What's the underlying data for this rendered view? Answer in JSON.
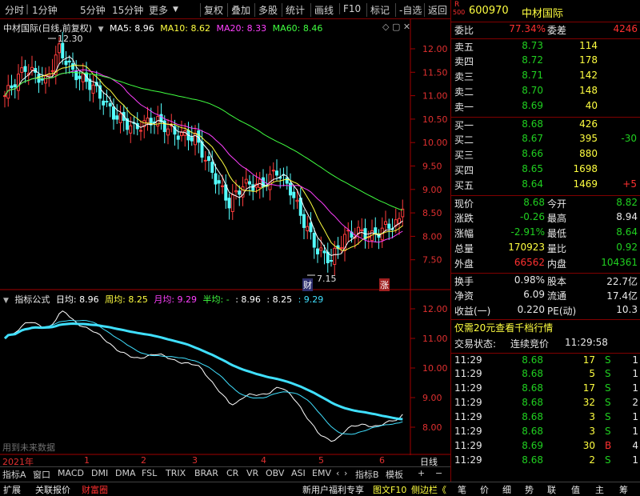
{
  "toolbar": {
    "left_items": [
      "分时",
      "1分钟",
      "5分钟",
      "15分钟",
      "更多"
    ],
    "right_items": [
      "复权",
      "叠加",
      "多股",
      "统计",
      "画线",
      "F10",
      "标记",
      "-自选",
      "返回"
    ]
  },
  "chart": {
    "stock_title": "中材国际(日线,前复权)",
    "ma_legend": [
      {
        "label": "MA5: 8.96",
        "color": "#ffffff"
      },
      {
        "label": "MA10: 8.62",
        "color": "#ffff40"
      },
      {
        "label": "MA20: 8.33",
        "color": "#ff40ff"
      },
      {
        "label": "MA60: 8.46",
        "color": "#40ff40"
      }
    ],
    "y_labels": [
      "12.00",
      "11.50",
      "11.00",
      "10.50",
      "10.00",
      "9.50",
      "9.00",
      "8.50",
      "8.00",
      "7.50"
    ],
    "high_marker": "12.30",
    "low_marker": "7.15",
    "badge_cai": "财",
    "badge_zhang": "涨",
    "indicator_name": "指标公式",
    "indicator_legend": [
      {
        "label": "日均: 8.96",
        "color": "#ffffff"
      },
      {
        "label": "周均: 8.25",
        "color": "#ffff40"
      },
      {
        "label": "月均: 9.29",
        "color": "#ff40ff"
      },
      {
        "label": "半均: -",
        "color": "#40ff40"
      },
      {
        "label": ": 8.96",
        "color": "#ffffff"
      },
      {
        "label": ": 8.25",
        "color": "#ffffff"
      },
      {
        "label": ": 9.29",
        "color": "#40e0ff"
      }
    ],
    "ind_y_labels": [
      "12.00",
      "11.00",
      "10.00",
      "9.00",
      "8.00"
    ],
    "future_data_note": "用到未来数据",
    "date_labels": [
      "2021年",
      "1",
      "2",
      "3",
      "4",
      "5",
      "6"
    ],
    "day_line_label": "日线"
  },
  "tabs": [
    "指标A",
    "窗口",
    "MACD",
    "DMI",
    "DMA",
    "FSL",
    "TRIX",
    "BRAR",
    "CR",
    "VR",
    "OBV",
    "ASI",
    "EMV"
  ],
  "tabs_right": [
    "指标B",
    "模板",
    "+",
    "−"
  ],
  "bottom": {
    "left": [
      "扩展",
      "关联报价",
      "财富圈"
    ],
    "right": [
      "新用户福利专享",
      "图文F10",
      "侧边栏《"
    ],
    "panel_tabs": [
      "笔",
      "价",
      "细",
      "势",
      "联",
      "值",
      "主",
      "筹"
    ]
  },
  "quote": {
    "code": "600970",
    "name": "中材国际",
    "r_label": "R",
    "market_code": "500",
    "weibi_label": "委比",
    "weibi_value": "77.34%",
    "weicha_label": "委差",
    "weicha_value": "4246",
    "asks": [
      {
        "label": "卖五",
        "price": "8.73",
        "vol": "114",
        "chg": ""
      },
      {
        "label": "卖四",
        "price": "8.72",
        "vol": "178",
        "chg": ""
      },
      {
        "label": "卖三",
        "price": "8.71",
        "vol": "142",
        "chg": ""
      },
      {
        "label": "卖二",
        "price": "8.70",
        "vol": "148",
        "chg": ""
      },
      {
        "label": "卖一",
        "price": "8.69",
        "vol": "40",
        "chg": ""
      }
    ],
    "bids": [
      {
        "label": "买一",
        "price": "8.68",
        "vol": "426",
        "chg": ""
      },
      {
        "label": "买二",
        "price": "8.67",
        "vol": "395",
        "chg": "-30"
      },
      {
        "label": "买三",
        "price": "8.66",
        "vol": "880",
        "chg": ""
      },
      {
        "label": "买四",
        "price": "8.65",
        "vol": "1698",
        "chg": ""
      },
      {
        "label": "买五",
        "price": "8.64",
        "vol": "1469",
        "chg": "+5"
      }
    ],
    "stats": [
      {
        "l1": "现价",
        "v1": "8.68",
        "c1": "green",
        "l2": "今开",
        "v2": "8.82",
        "c2": "green"
      },
      {
        "l1": "涨跌",
        "v1": "-0.26",
        "c1": "green",
        "l2": "最高",
        "v2": "8.94",
        "c2": "white"
      },
      {
        "l1": "涨幅",
        "v1": "-2.91%",
        "c1": "green",
        "l2": "最低",
        "v2": "8.64",
        "c2": "green"
      },
      {
        "l1": "总量",
        "v1": "170923",
        "c1": "yellow",
        "l2": "量比",
        "v2": "0.92",
        "c2": "green"
      },
      {
        "l1": "外盘",
        "v1": "66562",
        "c1": "red",
        "l2": "内盘",
        "v2": "104361",
        "c2": "green"
      }
    ],
    "stats2": [
      {
        "l1": "换手",
        "v1": "0.98%",
        "l2": "股本",
        "v2": "22.7亿"
      },
      {
        "l1": "净资",
        "v1": "6.09",
        "l2": "流通",
        "v2": "17.4亿"
      },
      {
        "l1": "收益(一)",
        "v1": "0.220",
        "l2": "PE(动)",
        "v2": "10.3"
      }
    ],
    "promo": "仅需20元查看千档行情",
    "status_label": "交易状态:",
    "status_value": "连续竞价",
    "status_time": "11:29:58",
    "ticks": [
      {
        "time": "11:29",
        "price": "8.68",
        "vol": "17",
        "bs": "S",
        "n": "1"
      },
      {
        "time": "11:29",
        "price": "8.68",
        "vol": "5",
        "bs": "S",
        "n": "1"
      },
      {
        "time": "11:29",
        "price": "8.68",
        "vol": "17",
        "bs": "S",
        "n": "1"
      },
      {
        "time": "11:29",
        "price": "8.68",
        "vol": "32",
        "bs": "S",
        "n": "2"
      },
      {
        "time": "11:29",
        "price": "8.68",
        "vol": "3",
        "bs": "S",
        "n": "1"
      },
      {
        "time": "11:29",
        "price": "8.68",
        "vol": "3",
        "bs": "S",
        "n": "1"
      },
      {
        "time": "11:29",
        "price": "8.69",
        "vol": "30",
        "bs": "B",
        "n": "4"
      },
      {
        "time": "11:29",
        "price": "8.68",
        "vol": "2",
        "bs": "S",
        "n": "1"
      }
    ]
  }
}
